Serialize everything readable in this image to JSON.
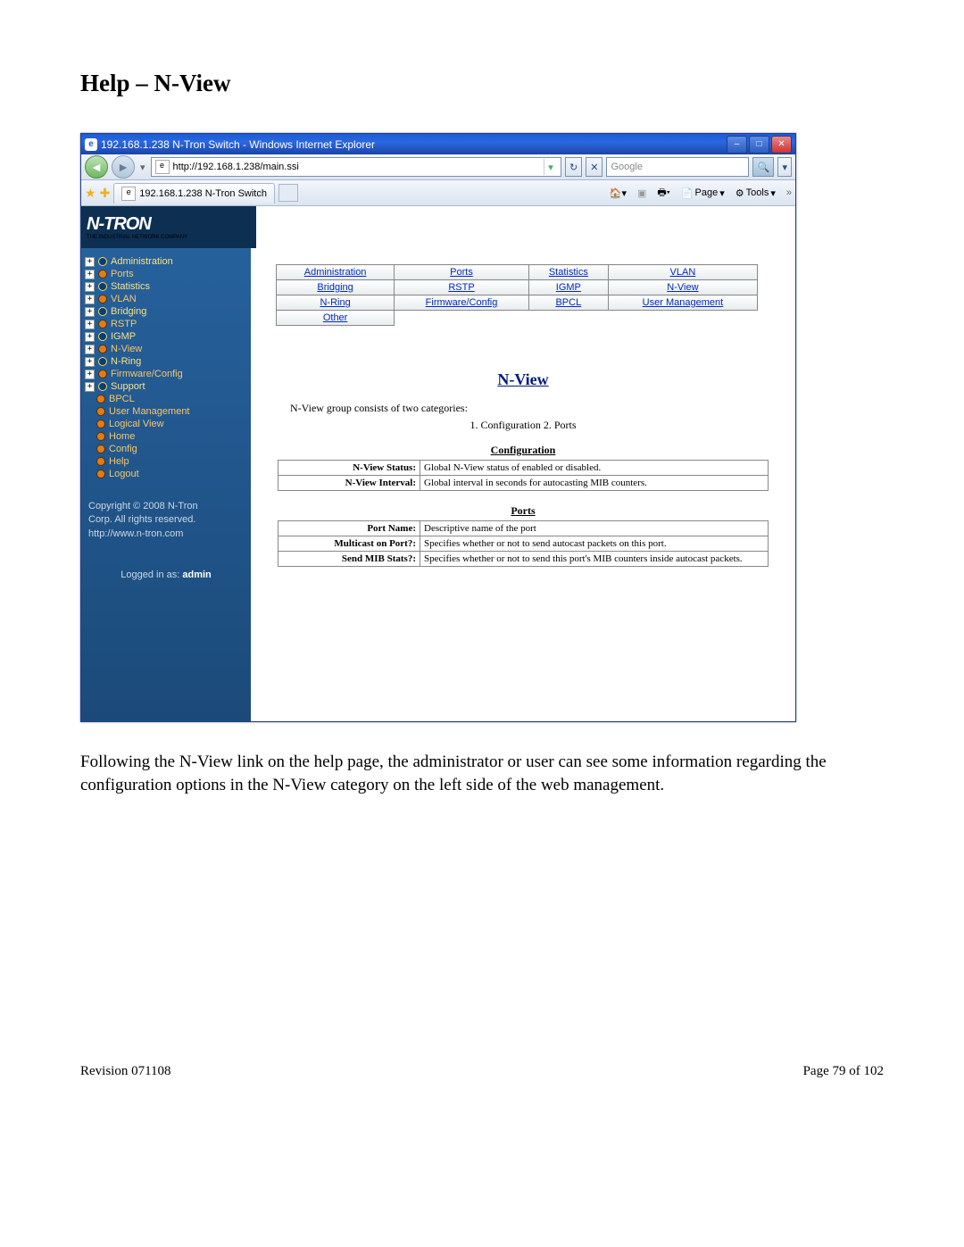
{
  "doc_title": "Help – N-View",
  "titlebar_text": "192.168.1.238 N-Tron Switch - Windows Internet Explorer",
  "address_url": "http://192.168.1.238/main.ssi",
  "search_placeholder": "Google",
  "tab_label": "192.168.1.238 N-Tron Switch",
  "toolbar": {
    "page": "Page",
    "tools": "Tools"
  },
  "logo_main": "N-TRON",
  "logo_sub": "THE INDUSTRIAL NETWORK COMPANY",
  "tree": [
    {
      "exp": "+",
      "label": "Administration"
    },
    {
      "exp": "+",
      "label": "Ports",
      "orange": true
    },
    {
      "exp": "+",
      "label": "Statistics"
    },
    {
      "exp": "+",
      "label": "VLAN",
      "orange": true
    },
    {
      "exp": "+",
      "label": "Bridging"
    },
    {
      "exp": "+",
      "label": "RSTP",
      "orange": true
    },
    {
      "exp": "+",
      "label": "IGMP"
    },
    {
      "exp": "+",
      "label": "N-View",
      "orange": true
    },
    {
      "exp": "+",
      "label": "N-Ring"
    },
    {
      "exp": "+",
      "label": "Firmware/Config",
      "orange": true
    },
    {
      "exp": "+",
      "label": "Support"
    },
    {
      "exp": " ",
      "label": "BPCL",
      "orange": true
    },
    {
      "exp": " ",
      "label": "User Management",
      "orange": true
    },
    {
      "exp": " ",
      "label": "Logical View",
      "orange": true
    },
    {
      "exp": " ",
      "label": "Home",
      "orange": true
    },
    {
      "exp": " ",
      "label": "Config",
      "orange": true
    },
    {
      "exp": " ",
      "label": "Help",
      "orange": true
    },
    {
      "exp": " ",
      "label": "Logout",
      "orange": true
    }
  ],
  "copyright_lines": [
    "Copyright © 2008 N-Tron",
    "Corp. All rights reserved.",
    "http://www.n-tron.com"
  ],
  "logged_in_prefix": "Logged in as: ",
  "logged_in_user": "admin",
  "help_links": [
    [
      "Administration",
      "Ports",
      "Statistics",
      "VLAN"
    ],
    [
      "Bridging",
      "RSTP",
      "IGMP",
      "N-View"
    ],
    [
      "N-Ring",
      "Firmware/Config",
      "BPCL",
      "User Management"
    ],
    [
      "Other",
      "",
      "",
      ""
    ]
  ],
  "section_title": "N-View",
  "section_desc": "N-View group consists of two categories:",
  "section_cats": "1. Configuration   2. Ports",
  "config_header": "Configuration",
  "config_rows": [
    {
      "k": "N-View Status:",
      "v": "Global N-View status of enabled or disabled."
    },
    {
      "k": "N-View Interval:",
      "v": "Global interval in seconds for autocasting MIB counters."
    }
  ],
  "ports_header": "Ports",
  "ports_rows": [
    {
      "k": "Port Name:",
      "v": "Descriptive name of the port"
    },
    {
      "k": "Multicast on Port?:",
      "v": "Specifies whether or not to send autocast packets on this port."
    },
    {
      "k": "Send MIB Stats?:",
      "v": "Specifies whether or not to send this port's MIB counters inside autocast packets."
    }
  ],
  "body_text": "Following the N-View link on the help page, the administrator or user can see some information regarding the configuration options in the N-View category on the left side of the web management.",
  "footer_left": "Revision 071108",
  "footer_right": "Page 79 of 102"
}
